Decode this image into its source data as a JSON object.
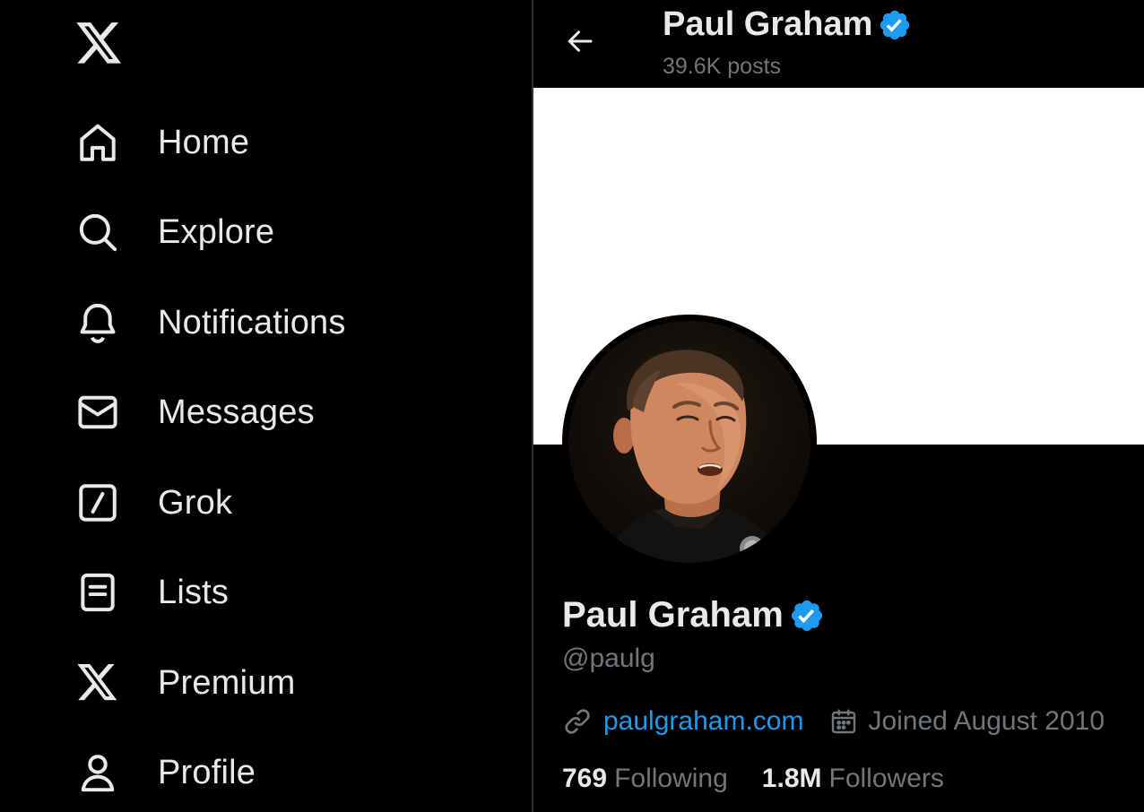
{
  "sidebar": {
    "logo": "x-logo-icon",
    "items": [
      {
        "label": "Home",
        "icon": "home-icon"
      },
      {
        "label": "Explore",
        "icon": "search-icon"
      },
      {
        "label": "Notifications",
        "icon": "bell-icon"
      },
      {
        "label": "Messages",
        "icon": "envelope-icon"
      },
      {
        "label": "Grok",
        "icon": "grok-icon"
      },
      {
        "label": "Lists",
        "icon": "lists-icon"
      },
      {
        "label": "Premium",
        "icon": "x-logo-icon"
      },
      {
        "label": "Profile",
        "icon": "person-icon"
      }
    ]
  },
  "header": {
    "name": "Paul Graham",
    "posts": "39.6K posts"
  },
  "profile": {
    "name": "Paul Graham",
    "handle": "@paulg",
    "website": "paulgraham.com",
    "joined": "Joined August 2010",
    "following_count": "769",
    "following_label": "Following",
    "followers_count": "1.8M",
    "followers_label": "Followers"
  },
  "colors": {
    "background": "#000000",
    "text": "#e7e9ea",
    "secondary_text": "#71767b",
    "accent": "#1d9bf0",
    "banner": "#ffffff"
  }
}
